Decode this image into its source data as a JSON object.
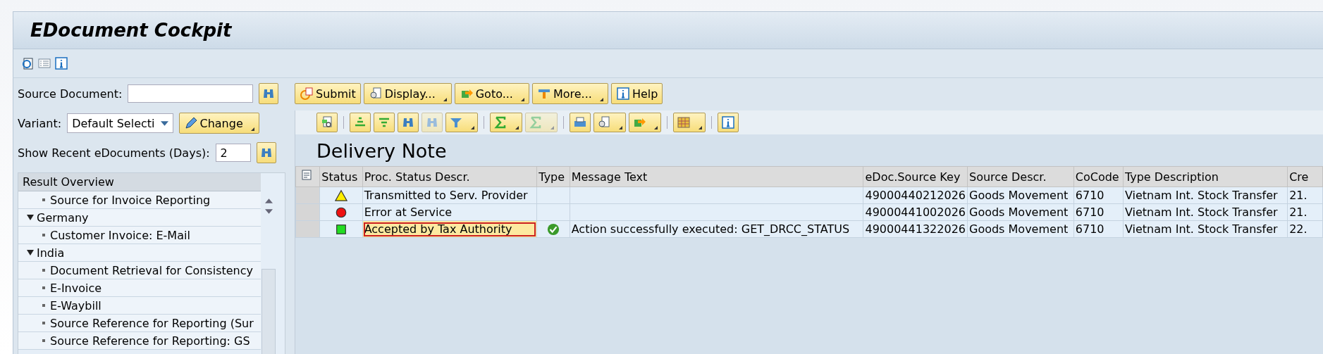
{
  "window": {
    "title": "EDocument Cockpit"
  },
  "app_toolbar": [
    {
      "kind": "refresh"
    },
    {
      "kind": "list"
    },
    {
      "kind": "info"
    }
  ],
  "source_document": {
    "label": "Source Document:"
  },
  "variant": {
    "label": "Variant:",
    "value": "Default Selecti",
    "button": "Change"
  },
  "recent": {
    "label": "Show Recent eDocuments (Days):",
    "value": "2"
  },
  "result_overview": {
    "title": "Result Overview",
    "items": [
      {
        "children": [
          {
            "label": "Source for Invoice Reporting"
          }
        ]
      },
      {
        "label": "Germany",
        "expanded": true,
        "children": [
          {
            "label": "Customer Invoice: E-Mail"
          }
        ]
      },
      {
        "label": "India",
        "expanded": true,
        "children": [
          {
            "label": "Document Retrieval for Consistency"
          },
          {
            "label": "E-Invoice"
          },
          {
            "label": "E-Waybill"
          },
          {
            "label": "Source Reference for Reporting (Sur"
          },
          {
            "label": "Source Reference for Reporting: GS"
          }
        ]
      }
    ]
  },
  "action_buttons": [
    {
      "kind": "submit",
      "label": "Submit",
      "dropdown": false
    },
    {
      "kind": "display",
      "label": "Display...",
      "dropdown": true
    },
    {
      "kind": "goto",
      "label": "Goto...",
      "dropdown": true
    },
    {
      "kind": "more",
      "label": "More...",
      "dropdown": true
    },
    {
      "kind": "help",
      "label": "Help",
      "dropdown": false
    }
  ],
  "alv_toolbar": [
    {
      "kind": "details",
      "dropdown": false,
      "disabled": false
    },
    {
      "kind": "separator"
    },
    {
      "kind": "sort-up",
      "dropdown": false,
      "disabled": false
    },
    {
      "kind": "sort-down",
      "dropdown": false,
      "disabled": false
    },
    {
      "kind": "find",
      "dropdown": false,
      "disabled": false
    },
    {
      "kind": "find-next",
      "dropdown": false,
      "disabled": true
    },
    {
      "kind": "filter",
      "dropdown": true,
      "disabled": false
    },
    {
      "kind": "separator"
    },
    {
      "kind": "sum",
      "dropdown": true,
      "disabled": false
    },
    {
      "kind": "subtotal",
      "dropdown": true,
      "disabled": true
    },
    {
      "kind": "separator"
    },
    {
      "kind": "print",
      "dropdown": false,
      "disabled": false
    },
    {
      "kind": "view",
      "dropdown": true,
      "disabled": false
    },
    {
      "kind": "export",
      "dropdown": true,
      "disabled": false
    },
    {
      "kind": "separator"
    },
    {
      "kind": "layout",
      "dropdown": true,
      "disabled": false
    },
    {
      "kind": "separator"
    },
    {
      "kind": "info",
      "dropdown": false,
      "disabled": false
    }
  ],
  "table": {
    "title": "Delivery Note",
    "columns": [
      "Status",
      "Proc. Status Descr.",
      "Type",
      "Message Text",
      "eDoc.Source Key",
      "Source Descr.",
      "CoCode",
      "Type Description",
      "Cre"
    ],
    "rows": [
      {
        "status": {
          "kind": "warning"
        },
        "proc_status": "Transmitted to Serv. Provider",
        "selected": false,
        "source_key": "49000440212026",
        "source_descr": "Goods Movement",
        "cocode": "6710",
        "type_description": "Vietnam Int. Stock Transfer",
        "column_9": "21."
      },
      {
        "status": {
          "kind": "error"
        },
        "proc_status": "Error at Service",
        "selected": false,
        "source_key": "49000441002026",
        "source_descr": "Goods Movement",
        "cocode": "6710",
        "type_description": "Vietnam Int. Stock Transfer",
        "column_9": "21."
      },
      {
        "status": {
          "kind": "success"
        },
        "proc_status": "Accepted by Tax Authority",
        "selected": true,
        "type": {
          "kind": "success"
        },
        "message": "Action successfully executed: GET_DRCC_STATUS",
        "source_key": "49000441322026",
        "source_descr": "Goods Movement",
        "cocode": "6710",
        "type_description": "Vietnam Int. Stock Transfer",
        "column_9": "22."
      }
    ]
  }
}
